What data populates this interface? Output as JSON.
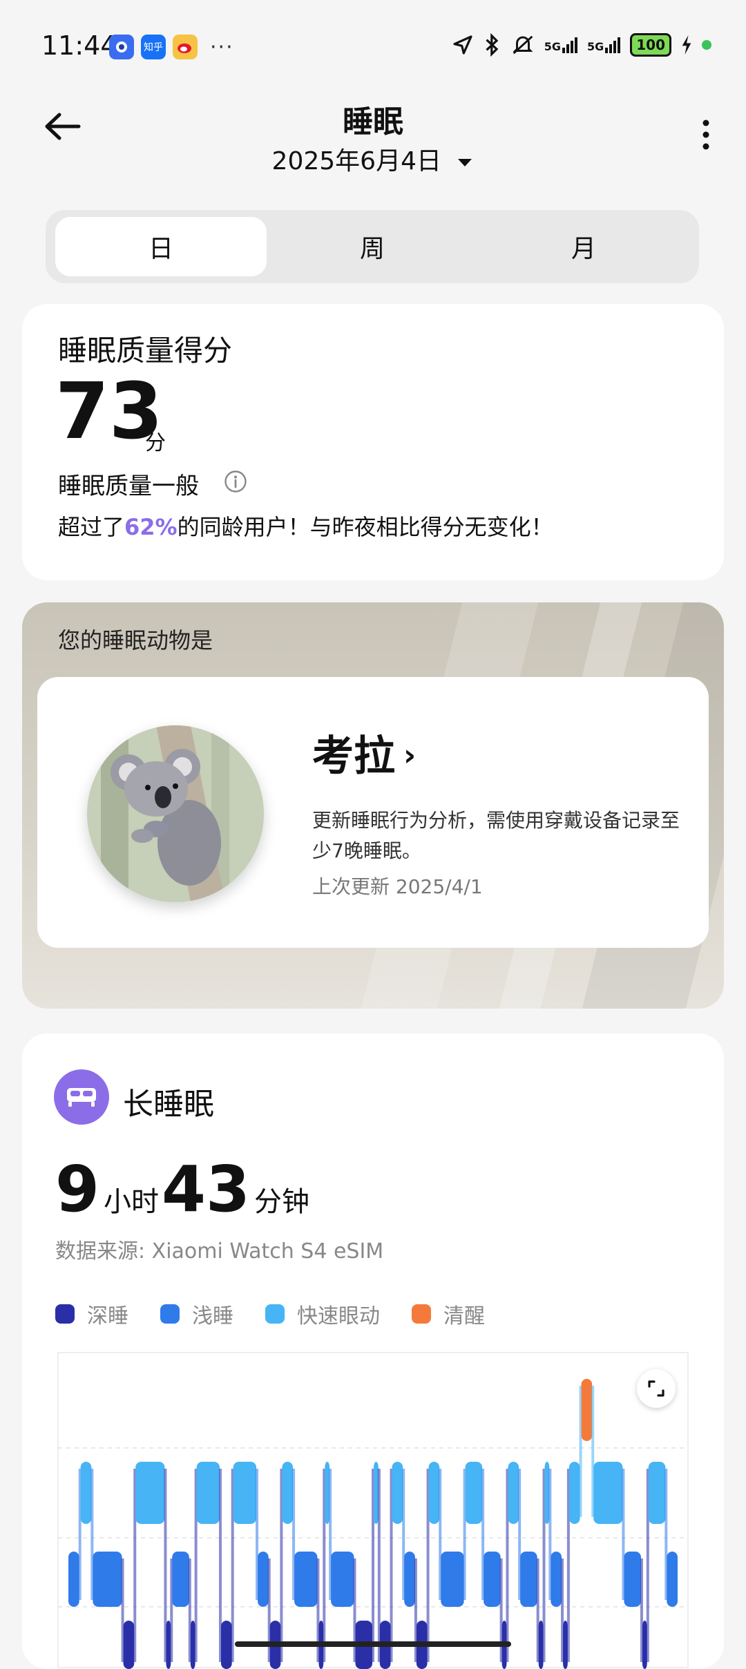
{
  "status_bar": {
    "time": "11:44",
    "apps": [
      {
        "icon": "blue-app-icon",
        "color": "#3a6cf0"
      },
      {
        "icon": "zhihu-icon",
        "label": "知乎",
        "color": "#1772f6"
      },
      {
        "icon": "weibo-icon",
        "color": "#f6c344"
      }
    ],
    "more": "···",
    "signal_labels": [
      "5G",
      "5G"
    ],
    "battery": "100"
  },
  "header": {
    "title": "睡眠",
    "date": "2025年6月4日"
  },
  "tabs": [
    {
      "label": "日",
      "active": true
    },
    {
      "label": "周",
      "active": false
    },
    {
      "label": "月",
      "active": false
    }
  ],
  "score_card": {
    "title": "睡眠质量得分",
    "score": "73",
    "unit": "分",
    "level": "睡眠质量一般",
    "desc_pre": "超过了",
    "desc_pct": "62%",
    "desc_post": "的同龄用户！与昨夜相比得分无变化！"
  },
  "animal_card": {
    "heading": "您的睡眠动物是",
    "name": "考拉",
    "chevron": "›",
    "description": "更新睡眠行为分析，需使用穿戴设备记录至少7晚睡眠。",
    "last_update": "上次更新 2025/4/1"
  },
  "sleep_card": {
    "title": "长睡眠",
    "hours": "9",
    "hours_unit": "小时",
    "minutes": "43",
    "minutes_unit": "分钟",
    "source": "数据来源: Xiaomi Watch S4 eSIM",
    "legend": [
      {
        "label": "深睡",
        "color": "#2a2fa8"
      },
      {
        "label": "浅睡",
        "color": "#2f7bea"
      },
      {
        "label": "快速眼动",
        "color": "#46b4f5"
      },
      {
        "label": "清醒",
        "color": "#f47a3c"
      }
    ]
  },
  "chart_data": {
    "type": "hypnogram",
    "levels": [
      "清醒",
      "快速眼动",
      "浅睡",
      "深睡"
    ],
    "colors": {
      "清醒": "#f47a3c",
      "快速眼动": "#46b4f5",
      "浅睡": "#2f7bea",
      "深睡": "#2a2fa8"
    },
    "segments": [
      {
        "stage": "浅睡",
        "start": 0,
        "end": 2
      },
      {
        "stage": "快速眼动",
        "start": 2,
        "end": 4
      },
      {
        "stage": "浅睡",
        "start": 4,
        "end": 9
      },
      {
        "stage": "深睡",
        "start": 9,
        "end": 11
      },
      {
        "stage": "快速眼动",
        "start": 11,
        "end": 16
      },
      {
        "stage": "深睡",
        "start": 16,
        "end": 17
      },
      {
        "stage": "浅睡",
        "start": 17,
        "end": 20
      },
      {
        "stage": "深睡",
        "start": 20,
        "end": 21
      },
      {
        "stage": "快速眼动",
        "start": 21,
        "end": 25
      },
      {
        "stage": "深睡",
        "start": 25,
        "end": 27
      },
      {
        "stage": "快速眼动",
        "start": 27,
        "end": 31
      },
      {
        "stage": "浅睡",
        "start": 31,
        "end": 33
      },
      {
        "stage": "深睡",
        "start": 33,
        "end": 35
      },
      {
        "stage": "快速眼动",
        "start": 35,
        "end": 37
      },
      {
        "stage": "浅睡",
        "start": 37,
        "end": 41
      },
      {
        "stage": "深睡",
        "start": 41,
        "end": 42
      },
      {
        "stage": "快速眼动",
        "start": 42,
        "end": 43
      },
      {
        "stage": "浅睡",
        "start": 43,
        "end": 47
      },
      {
        "stage": "深睡",
        "start": 47,
        "end": 50
      },
      {
        "stage": "快速眼动",
        "start": 50,
        "end": 51
      },
      {
        "stage": "深睡",
        "start": 51,
        "end": 53
      },
      {
        "stage": "快速眼动",
        "start": 53,
        "end": 55
      },
      {
        "stage": "浅睡",
        "start": 55,
        "end": 57
      },
      {
        "stage": "深睡",
        "start": 57,
        "end": 59
      },
      {
        "stage": "快速眼动",
        "start": 59,
        "end": 61
      },
      {
        "stage": "浅睡",
        "start": 61,
        "end": 65
      },
      {
        "stage": "快速眼动",
        "start": 65,
        "end": 68
      },
      {
        "stage": "浅睡",
        "start": 68,
        "end": 71
      },
      {
        "stage": "深睡",
        "start": 71,
        "end": 72
      },
      {
        "stage": "快速眼动",
        "start": 72,
        "end": 74
      },
      {
        "stage": "浅睡",
        "start": 74,
        "end": 77
      },
      {
        "stage": "深睡",
        "start": 77,
        "end": 78
      },
      {
        "stage": "快速眼动",
        "start": 78,
        "end": 79
      },
      {
        "stage": "浅睡",
        "start": 79,
        "end": 81
      },
      {
        "stage": "深睡",
        "start": 81,
        "end": 82
      },
      {
        "stage": "快速眼动",
        "start": 82,
        "end": 84
      },
      {
        "stage": "清醒",
        "start": 84,
        "end": 86
      },
      {
        "stage": "快速眼动",
        "start": 86,
        "end": 91
      },
      {
        "stage": "浅睡",
        "start": 91,
        "end": 94
      },
      {
        "stage": "深睡",
        "start": 94,
        "end": 95
      },
      {
        "stage": "快速眼动",
        "start": 95,
        "end": 98
      },
      {
        "stage": "浅睡",
        "start": 98,
        "end": 100
      }
    ],
    "x_range": [
      0,
      100
    ],
    "grid": true
  }
}
